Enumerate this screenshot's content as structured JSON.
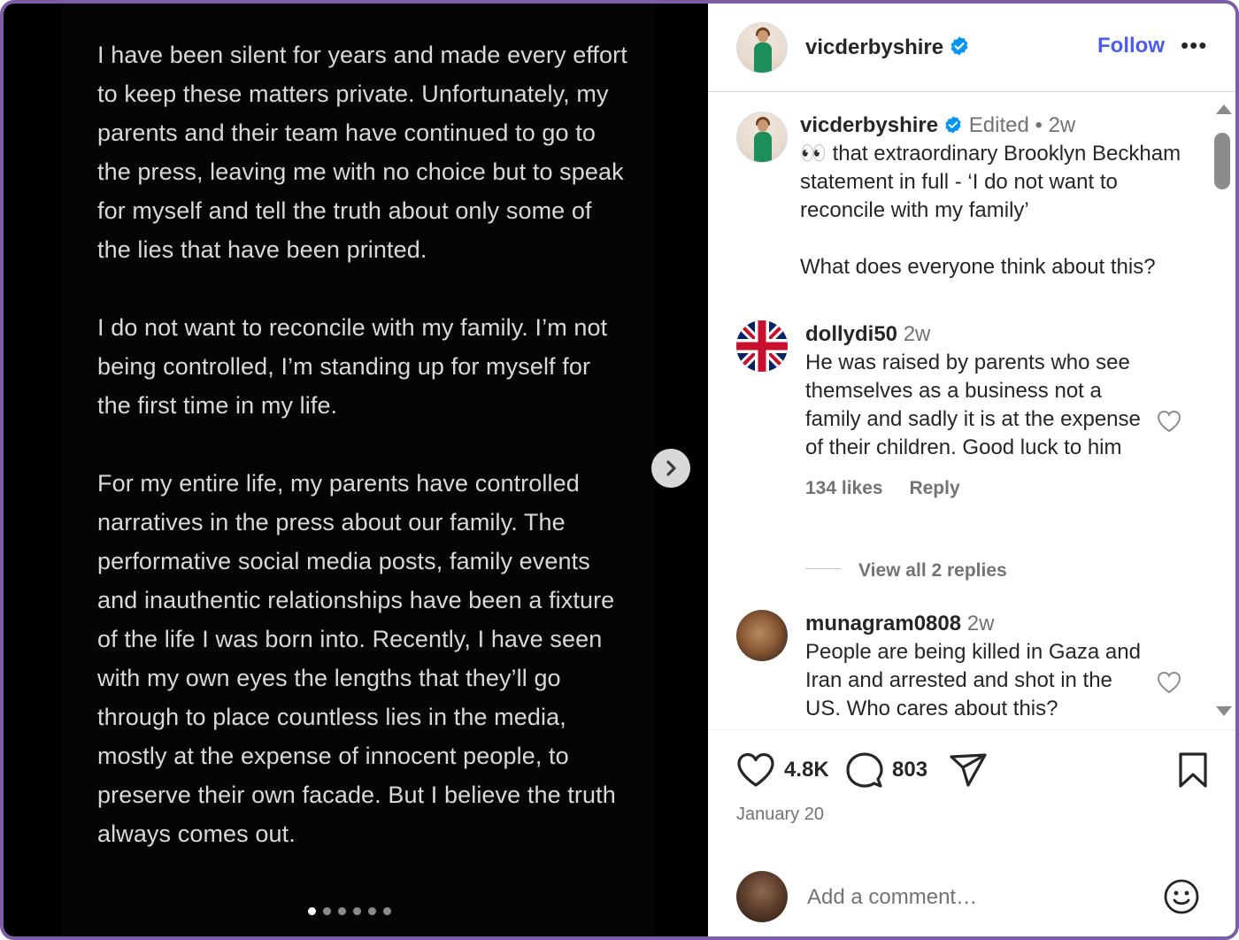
{
  "media": {
    "paragraphs": [
      "I have been silent for years and made every effort to keep these matters private. Unfortunately, my parents and their team have continued to go to the press, leaving me with no choice but to speak for myself and tell the truth about only some of the lies that have been printed.",
      "I do not want to reconcile with my family. I’m not being controlled, I’m standing up for myself for the first time in my life.",
      "For my entire life, my parents have controlled narratives in the press about our family. The performative social media posts, family events and inauthentic relationships have been a fixture of the life I was born into. Recently, I have seen with my own eyes the lengths that they’ll go through to place countless lies in the media, mostly at the expense of innocent people, to preserve their own facade. But I believe the truth always comes out."
    ],
    "slide_count": 6,
    "active_slide": 1
  },
  "header": {
    "username": "vicderbyshire",
    "follow_label": "Follow",
    "more_label": "•••"
  },
  "caption": {
    "username": "vicderbyshire",
    "edited": "Edited",
    "separator": "•",
    "time": "2w",
    "emoji": "👀",
    "text": "that extraordinary Brooklyn Beckham statement in full - ‘I do not want to reconcile with my family’",
    "question": "What does everyone think about this?"
  },
  "comments": [
    {
      "username": "dollydi50",
      "time": "2w",
      "text": "He was raised by parents who see themselves as a business not a family and sadly it is at the expense of their children. Good luck to him",
      "likes": "134 likes",
      "reply_label": "Reply",
      "view_replies": "View all 2 replies"
    },
    {
      "username": "munagram0808",
      "time": "2w",
      "text": "People are being killed in Gaza and Iran and arrested and shot in the US. Who cares about this?"
    }
  ],
  "actions": {
    "likes_count": "4.8K",
    "comments_count": "803",
    "date": "January 20"
  },
  "composer": {
    "placeholder": "Add a comment…"
  },
  "colors": {
    "accent": "#4a5cf0",
    "verified": "#0095f6",
    "frame": "#7b5ea7"
  }
}
